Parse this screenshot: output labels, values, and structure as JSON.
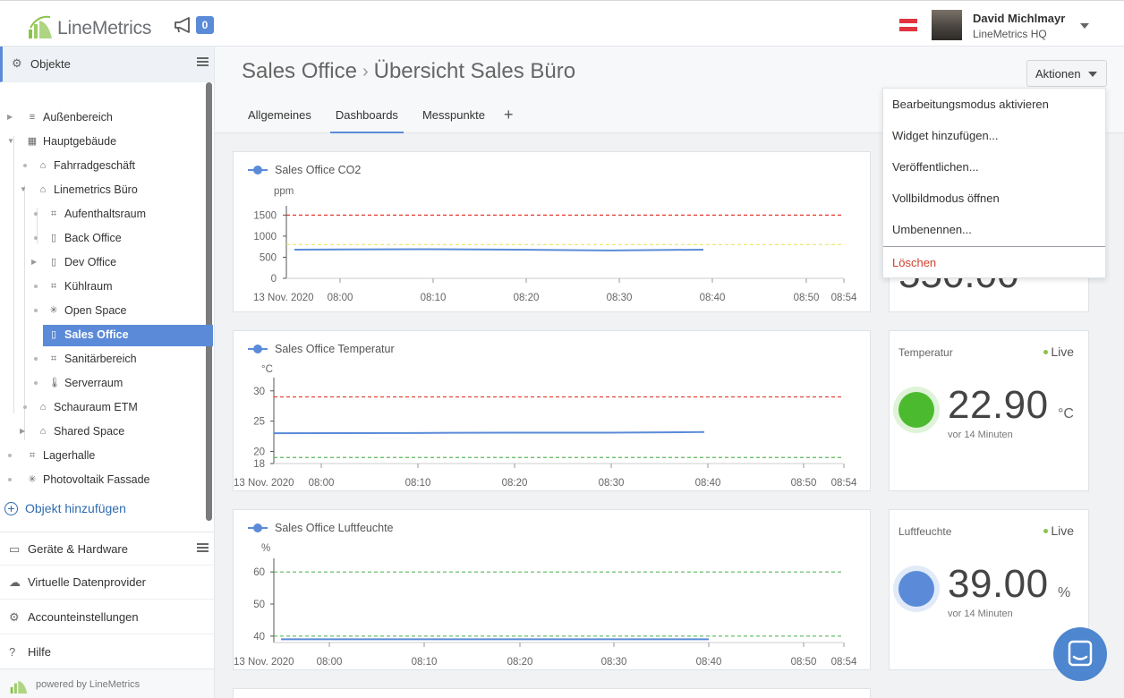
{
  "header": {
    "logo_text": "LineMetrics",
    "announcement_count": "0",
    "user_name": "David Michlmayr",
    "user_org": "LineMetrics HQ"
  },
  "sidebar": {
    "objects_label": "Objekte",
    "tree": [
      {
        "label": "Außenbereich",
        "icon": "area-icon"
      },
      {
        "label": "Hauptgebäude",
        "icon": "building-icon"
      },
      {
        "label": "Fahrradgeschäft",
        "icon": "group-icon"
      },
      {
        "label": "Linemetrics Büro",
        "icon": "group-icon"
      },
      {
        "label": "Aufenthaltsraum",
        "icon": "room-icon"
      },
      {
        "label": "Back Office",
        "icon": "door-icon"
      },
      {
        "label": "Dev Office",
        "icon": "door-icon"
      },
      {
        "label": "Kühlraum",
        "icon": "room-icon"
      },
      {
        "label": "Open Space",
        "icon": "loading-icon"
      },
      {
        "label": "Sales Office",
        "icon": "door-icon"
      },
      {
        "label": "Sanitärbereich",
        "icon": "room-icon"
      },
      {
        "label": "Serverraum",
        "icon": "thermometer-icon"
      },
      {
        "label": "Schauraum ETM",
        "icon": "group-icon"
      },
      {
        "label": "Shared Space",
        "icon": "group-icon"
      },
      {
        "label": "Lagerhalle",
        "icon": "room-icon"
      },
      {
        "label": "Photovoltaik Fassade",
        "icon": "loading-icon"
      }
    ],
    "add_object": "Objekt hinzufügen",
    "sections": {
      "devices": "Geräte & Hardware",
      "virtual": "Virtuelle Datenprovider",
      "account": "Accounteinstellungen",
      "help": "Hilfe"
    },
    "powered_by": "powered by LineMetrics"
  },
  "main": {
    "breadcrumb_parent": "Sales Office",
    "breadcrumb_current": "Übersicht Sales Büro",
    "tabs": [
      "Allgemeines",
      "Dashboards",
      "Messpunkte"
    ],
    "actions_label": "Aktionen",
    "actions_menu": [
      "Bearbeitungsmodus aktivieren",
      "Widget hinzufügen...",
      "Veröffentlichen...",
      "Vollbildmodus öffnen",
      "Umbenennen...",
      "Löschen"
    ]
  },
  "widgets": [
    {
      "title": "Temperatur",
      "live": "Live",
      "value": "22.90",
      "unit": "°C",
      "ago": "vor 14 Minuten",
      "color": "#4cba2e"
    },
    {
      "title": "Luftfeuchte",
      "live": "Live",
      "value": "39.00",
      "unit": "%",
      "ago": "vor 14 Minuten",
      "color": "#5b8bd8"
    }
  ],
  "co2_clipped_value": "550.00",
  "chart_data": [
    {
      "type": "line",
      "title": "Sales Office CO2",
      "ylabel": "ppm",
      "yticks": [
        "0",
        "500",
        "1000",
        "1500"
      ],
      "ylim": [
        0,
        1550
      ],
      "x_start_label": "13 Nov. 2020",
      "xticks": [
        "08:00",
        "08:10",
        "08:20",
        "08:30",
        "08:40",
        "08:50",
        "08:54"
      ],
      "series": [
        {
          "x": [
            "08:00",
            "08:10",
            "08:20",
            "08:30",
            "08:40"
          ],
          "values": [
            680,
            690,
            680,
            660,
            680
          ]
        }
      ],
      "thresholds": [
        {
          "value": 1500,
          "color": "#e03c2f"
        },
        {
          "value": 800,
          "color": "#e8e86a"
        }
      ],
      "color": "#5b8bd8"
    },
    {
      "type": "line",
      "title": "Sales Office Temperatur",
      "ylabel": "°C",
      "yticks": [
        "18",
        "20",
        "25",
        "30"
      ],
      "ylim": [
        18,
        31
      ],
      "x_start_label": "13 Nov. 2020",
      "xticks": [
        "08:00",
        "08:10",
        "08:20",
        "08:30",
        "08:40",
        "08:50",
        "08:54"
      ],
      "series": [
        {
          "x": [
            "08:00",
            "08:10",
            "08:20",
            "08:30",
            "08:40"
          ],
          "values": [
            23.0,
            23.05,
            23.1,
            23.1,
            23.2
          ]
        }
      ],
      "thresholds": [
        {
          "value": 29,
          "color": "#e03c2f"
        },
        {
          "value": 19,
          "color": "#5cb85c"
        }
      ],
      "color": "#5b8bd8"
    },
    {
      "type": "line",
      "title": "Sales Office Luftfeuchte",
      "ylabel": "%",
      "yticks": [
        "40",
        "50",
        "60"
      ],
      "ylim": [
        38,
        62
      ],
      "x_start_label": "13 Nov. 2020",
      "xticks": [
        "08:00",
        "08:10",
        "08:20",
        "08:30",
        "08:40",
        "08:50",
        "08:54"
      ],
      "series": [
        {
          "x": [
            "08:00",
            "08:10",
            "08:20",
            "08:30",
            "08:40"
          ],
          "values": [
            39,
            39,
            39,
            39,
            39
          ]
        }
      ],
      "thresholds": [
        {
          "value": 60,
          "color": "#5cb85c"
        },
        {
          "value": 40,
          "color": "#5cb85c"
        }
      ],
      "color": "#5b8bd8"
    }
  ]
}
